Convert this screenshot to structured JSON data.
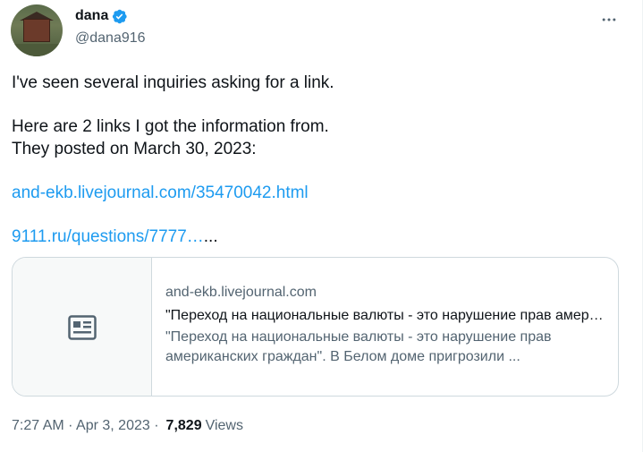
{
  "author": {
    "display_name": "dana",
    "handle": "@dana916",
    "verified": true
  },
  "tweet": {
    "lines": [
      "I've seen several inquiries asking for a link.",
      "Here are 2 links I got the information from.\nThey posted on March 30, 2023:"
    ],
    "link1": "and-ekb.livejournal.com/35470042.html",
    "link2": "9111.ru/questions/7777…",
    "link2_suffix": "...",
    "timestamp": "7:27 AM · Apr 3, 2023 ·",
    "views_count": "7,829",
    "views_label": "Views"
  },
  "card": {
    "domain": "and-ekb.livejournal.com",
    "title": "\"Переход на национальные валюты - это нарушение прав американских граждан\". В Белом доме пригрозили ...",
    "description": "\"Переход на национальные валюты - это нарушение прав американских граждан\". В Белом доме пригрозили ..."
  },
  "colors": {
    "link": "#1d9bf0",
    "text_primary": "#0f1419",
    "text_secondary": "#536471",
    "border": "#cfd9de",
    "verified_badge": "#1d9bf0"
  },
  "icons": {
    "more": "more-horizontal-icon",
    "card_placeholder": "article-icon",
    "verified": "verified-badge-icon"
  }
}
